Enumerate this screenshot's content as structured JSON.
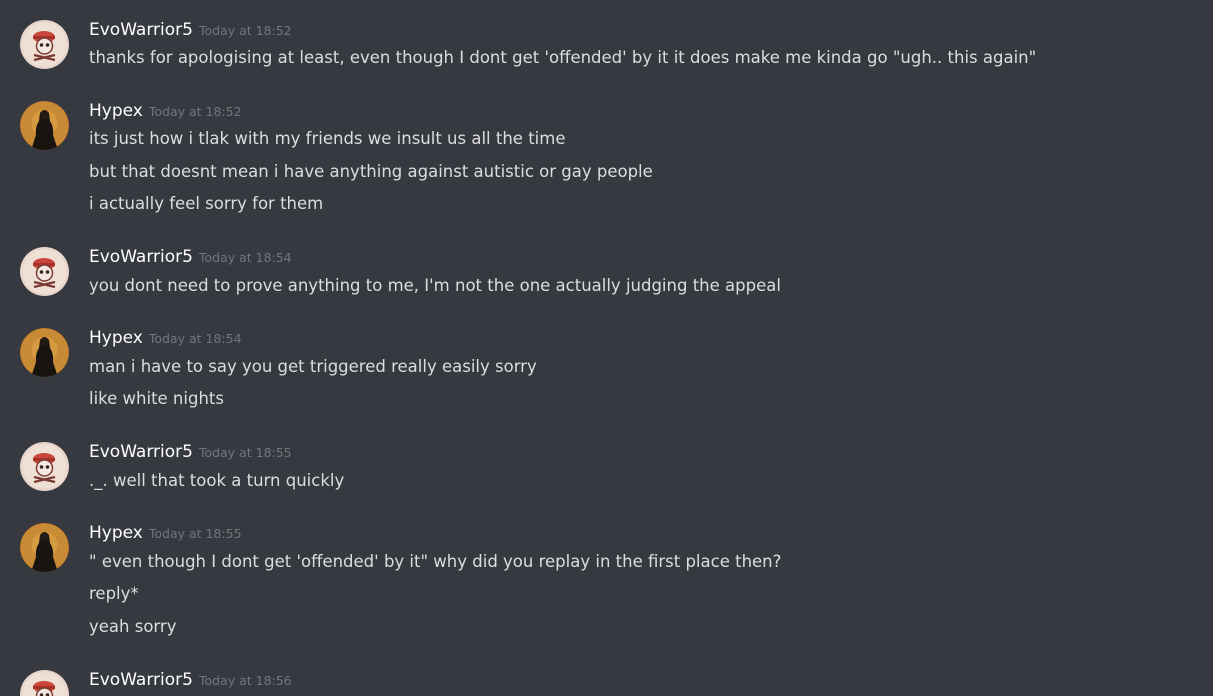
{
  "messages": [
    {
      "author": "EvoWarrior5",
      "time": "Today at 18:52",
      "lines": [
        "thanks for apologising at least, even though I dont get 'offended' by it it does make me kinda go \"ugh.. this again\""
      ]
    },
    {
      "author": "Hypex",
      "time": "Today at 18:52",
      "lines": [
        "its just how i tlak with my friends we insult us all the time",
        "but that doesnt mean i have anything against autistic or gay people",
        "i actually feel sorry for them"
      ]
    },
    {
      "author": "EvoWarrior5",
      "time": "Today at 18:54",
      "lines": [
        "you dont need to prove anything to me, I'm not the one actually judging the appeal"
      ]
    },
    {
      "author": "Hypex",
      "time": "Today at 18:54",
      "lines": [
        "man i have to say you get triggered really easily sorry",
        "like white nights"
      ]
    },
    {
      "author": "EvoWarrior5",
      "time": "Today at 18:55",
      "lines": [
        "._. well that took a turn quickly"
      ]
    },
    {
      "author": "Hypex",
      "time": "Today at 18:55",
      "lines": [
        "\" even though I dont get 'offended' by it\" why did you replay in the first place then?",
        "reply*",
        "yeah sorry"
      ]
    },
    {
      "author": "EvoWarrior5",
      "time": "Today at 18:56",
      "lines": []
    }
  ],
  "colors": {
    "background": "#36393f",
    "username": "#ffffff",
    "timestamp": "#72767d",
    "text": "#dcddde"
  },
  "icons": {
    "evowarrior_avatar": "skull-pirate-avatar-icon",
    "hypex_avatar": "dark-figure-avatar-icon"
  }
}
